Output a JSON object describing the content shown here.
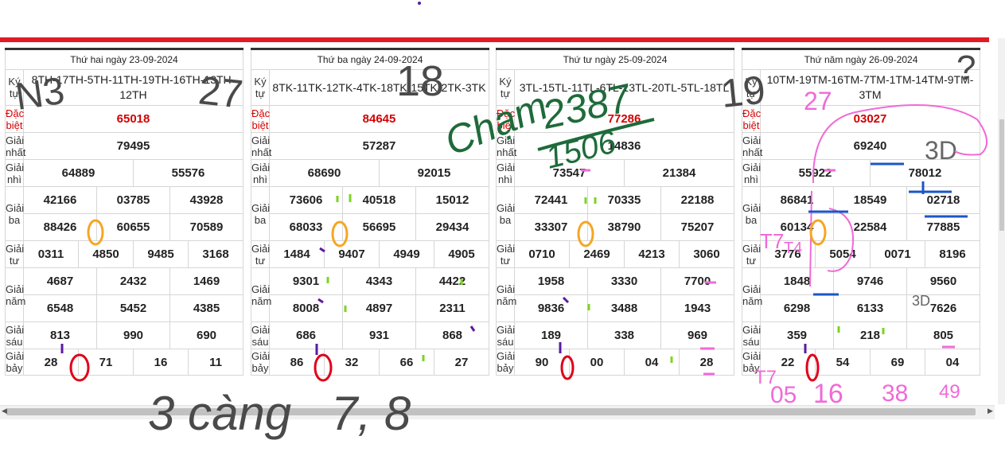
{
  "labels": {
    "ky_tu": "Ký tự",
    "dac_biet": "Đặc biệt",
    "giai_nhat": "Giải nhất",
    "giai_nhi": "Giải nhì",
    "giai_ba": "Giải ba",
    "giai_tu": "Giải tư",
    "giai_nam": "Giải năm",
    "giai_sau": "Giải sáu",
    "giai_bay": "Giải bảy"
  },
  "results": [
    {
      "date_header": "Thứ hai ngày 23-09-2024",
      "ky_tu": "8TH-17TH-5TH-11TH-19TH-16TH-13TH-12TH",
      "dac_biet": "65018",
      "giai_nhat": "79495",
      "giai_nhi": [
        "64889",
        "55576"
      ],
      "giai_ba": [
        "42166",
        "03785",
        "43928",
        "88426",
        "60655",
        "70589"
      ],
      "giai_tu": [
        "0311",
        "4850",
        "9485",
        "3168"
      ],
      "giai_nam": [
        "4687",
        "2432",
        "1469",
        "6548",
        "5452",
        "4385"
      ],
      "giai_sau": [
        "813",
        "990",
        "690"
      ],
      "giai_bay": [
        "28",
        "71",
        "16",
        "11"
      ]
    },
    {
      "date_header": "Thứ ba ngày 24-09-2024",
      "ky_tu": "8TK-11TK-12TK-4TK-18TK-15TK-2TK-3TK",
      "dac_biet": "84645",
      "giai_nhat": "57287",
      "giai_nhi": [
        "68690",
        "92015"
      ],
      "giai_ba": [
        "73606",
        "40518",
        "15012",
        "68033",
        "56695",
        "29434"
      ],
      "giai_tu": [
        "1484",
        "9407",
        "4949",
        "4905"
      ],
      "giai_nam": [
        "9301",
        "4343",
        "4422",
        "8008",
        "4897",
        "2311"
      ],
      "giai_sau": [
        "686",
        "931",
        "868"
      ],
      "giai_bay": [
        "86",
        "32",
        "66",
        "27"
      ]
    },
    {
      "date_header": "Thứ tư ngày 25-09-2024",
      "ky_tu": "3TL-15TL-11TL-6TL-13TL-20TL-5TL-18TL",
      "dac_biet": "77286",
      "giai_nhat": "14836",
      "giai_nhi": [
        "73547",
        "21384"
      ],
      "giai_ba": [
        "72441",
        "70335",
        "22188",
        "33307",
        "38790",
        "75207"
      ],
      "giai_tu": [
        "0710",
        "2469",
        "4213",
        "3060"
      ],
      "giai_nam": [
        "1958",
        "3330",
        "7700",
        "9836",
        "3488",
        "1943"
      ],
      "giai_sau": [
        "189",
        "338",
        "969"
      ],
      "giai_bay": [
        "90",
        "00",
        "04",
        "28"
      ]
    },
    {
      "date_header": "Thứ năm ngày 26-09-2024",
      "ky_tu": "10TM-19TM-16TM-7TM-1TM-14TM-9TM-3TM",
      "dac_biet": "03027",
      "giai_nhat": "69240",
      "giai_nhi": [
        "55922",
        "78012"
      ],
      "giai_ba": [
        "86841",
        "18549",
        "02718",
        "60134",
        "22584",
        "77885"
      ],
      "giai_tu": [
        "3776",
        "5054",
        "0071",
        "8196"
      ],
      "giai_nam": [
        "1848",
        "9746",
        "9560",
        "6298",
        "6133",
        "7626"
      ],
      "giai_sau": [
        "359",
        "218",
        "805"
      ],
      "giai_bay": [
        "22",
        "54",
        "69",
        "04"
      ]
    }
  ],
  "annotations": {
    "top_notes": [
      "N3",
      "27",
      "18",
      "19",
      "?"
    ],
    "cham_note": "Chạm",
    "numbers_note": [
      "2387",
      "1506"
    ],
    "bottom_note": "3 càng   7, 8",
    "pink_notes": [
      "27",
      "3D",
      "T7",
      "T4",
      "3D"
    ],
    "pink_bottom": [
      "T7",
      "05",
      "16",
      "38",
      "49"
    ]
  },
  "colors": {
    "accent_red": "#e01b24",
    "prize_red": "#d40000",
    "ink_dark": "#4a4a4a",
    "ink_green": "#1e6b3a",
    "ink_pink": "#f06ad8",
    "mark_orange": "#f5a623",
    "mark_red": "#e0001a",
    "mark_blue": "#1a56c8",
    "mark_purple": "#5a1aa0",
    "mark_lime": "#7ed321"
  }
}
